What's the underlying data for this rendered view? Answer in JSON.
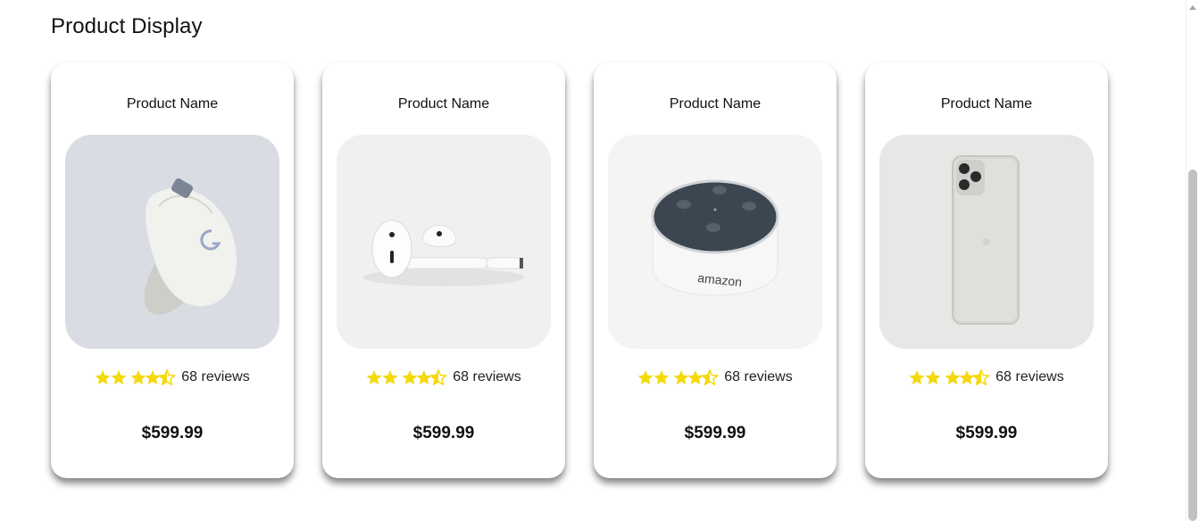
{
  "page": {
    "title": "Product Display"
  },
  "products": [
    {
      "name": "Product Name",
      "image": "gaming-mouse",
      "stars": 4.5,
      "reviews": "68 reviews",
      "price": "$599.99"
    },
    {
      "name": "Product Name",
      "image": "wireless-earbuds",
      "stars": 4.5,
      "reviews": "68 reviews",
      "price": "$599.99"
    },
    {
      "name": "Product Name",
      "image": "smart-speaker",
      "image_text": "amazon",
      "stars": 4.5,
      "reviews": "68 reviews",
      "price": "$599.99"
    },
    {
      "name": "Product Name",
      "image": "smartphone",
      "stars": 4.5,
      "reviews": "68 reviews",
      "price": "$599.99"
    }
  ],
  "colors": {
    "star": "#f5d90a",
    "card_bg": "#ffffff",
    "text": "#111111"
  }
}
